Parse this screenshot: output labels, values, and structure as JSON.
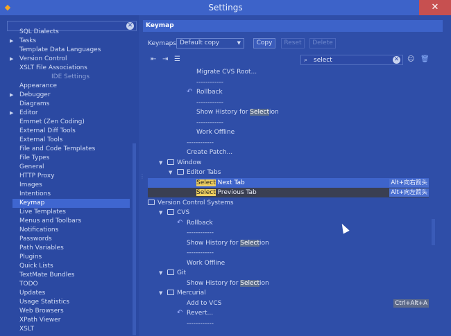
{
  "window": {
    "title": "Settings",
    "close": "✕",
    "app_icon": "intellij-icon"
  },
  "sidebar": {
    "items": [
      {
        "label": "SQL Dialects",
        "arrow": false
      },
      {
        "label": "Tasks",
        "arrow": true
      },
      {
        "label": "Template Data Languages",
        "arrow": false
      },
      {
        "label": "Version Control",
        "arrow": true
      },
      {
        "label": "XSLT File Associations",
        "arrow": false
      },
      {
        "label": "IDE Settings",
        "section": true
      },
      {
        "label": "Appearance",
        "arrow": false
      },
      {
        "label": "Debugger",
        "arrow": true
      },
      {
        "label": "Diagrams",
        "arrow": false
      },
      {
        "label": "Editor",
        "arrow": true
      },
      {
        "label": "Emmet (Zen Coding)",
        "arrow": false
      },
      {
        "label": "External Diff Tools",
        "arrow": false
      },
      {
        "label": "External Tools",
        "arrow": false
      },
      {
        "label": "File and Code Templates",
        "arrow": false
      },
      {
        "label": "File Types",
        "arrow": false
      },
      {
        "label": "General",
        "arrow": false
      },
      {
        "label": "HTTP Proxy",
        "arrow": false
      },
      {
        "label": "Images",
        "arrow": false
      },
      {
        "label": "Intentions",
        "arrow": false
      },
      {
        "label": "Keymap",
        "arrow": false,
        "selected": true
      },
      {
        "label": "Live Templates",
        "arrow": false
      },
      {
        "label": "Menus and Toolbars",
        "arrow": false
      },
      {
        "label": "Notifications",
        "arrow": false
      },
      {
        "label": "Passwords",
        "arrow": false
      },
      {
        "label": "Path Variables",
        "arrow": false
      },
      {
        "label": "Plugins",
        "arrow": false
      },
      {
        "label": "Quick Lists",
        "arrow": false
      },
      {
        "label": "TextMate Bundles",
        "arrow": false
      },
      {
        "label": "TODO",
        "arrow": false
      },
      {
        "label": "Updates",
        "arrow": false
      },
      {
        "label": "Usage Statistics",
        "arrow": false
      },
      {
        "label": "Web Browsers",
        "arrow": false
      },
      {
        "label": "XPath Viewer",
        "arrow": false
      },
      {
        "label": "XSLT",
        "arrow": false
      }
    ]
  },
  "keymap": {
    "header": "Keymap",
    "keymaps_label": "Keymaps:",
    "selected_keymap": "Default copy",
    "copy_label": "Copy",
    "reset_label": "Reset",
    "delete_label": "Delete",
    "filter_value": "select"
  },
  "actions": [
    {
      "indent": 70,
      "text": "Migrate CVS Root..."
    },
    {
      "indent": 70,
      "text": "------------"
    },
    {
      "indent": 70,
      "text": "Rollback",
      "undo": true
    },
    {
      "indent": 70,
      "text": "------------"
    },
    {
      "indent": 70,
      "pre": "Show History for ",
      "hl": "Select",
      "post": "ion"
    },
    {
      "indent": 70,
      "text": "------------"
    },
    {
      "indent": 70,
      "text": "Work Offline"
    },
    {
      "indent": 56,
      "text": "------------"
    },
    {
      "indent": 56,
      "text": "Create Patch..."
    },
    {
      "indent": 42,
      "text": "Window",
      "folder": true,
      "tri": true
    },
    {
      "indent": 56,
      "text": "Editor Tabs",
      "folder": true,
      "tri": true
    },
    {
      "indent": 70,
      "hl": "Select",
      "post": " Next Tab",
      "shortcut": "Alt+向右箭头",
      "state": "selected"
    },
    {
      "indent": 70,
      "hl": "Select",
      "post": " Previous Tab",
      "shortcut": "Alt+向左箭头",
      "state": "dark"
    },
    {
      "indent": 14,
      "text": "Version Control Systems",
      "folder": true,
      "tri": true
    },
    {
      "indent": 42,
      "text": "CVS",
      "folder": true,
      "tri": true
    },
    {
      "indent": 56,
      "text": "Rollback",
      "undo": true
    },
    {
      "indent": 56,
      "text": "------------"
    },
    {
      "indent": 56,
      "pre": "Show History for ",
      "hl": "Select",
      "post": "ion"
    },
    {
      "indent": 56,
      "text": "------------"
    },
    {
      "indent": 56,
      "text": "Work Offline"
    },
    {
      "indent": 42,
      "text": "Git",
      "folder": true,
      "tri": true
    },
    {
      "indent": 56,
      "pre": "Show History for ",
      "hl": "Select",
      "post": "ion"
    },
    {
      "indent": 42,
      "text": "Mercurial",
      "folder": true,
      "tri": true
    },
    {
      "indent": 56,
      "text": "Add to VCS",
      "shortcut": "Ctrl+Alt+A",
      "shortcut_gray": true
    },
    {
      "indent": 56,
      "text": "Revert...",
      "undo": true
    },
    {
      "indent": 56,
      "text": "------------"
    }
  ]
}
